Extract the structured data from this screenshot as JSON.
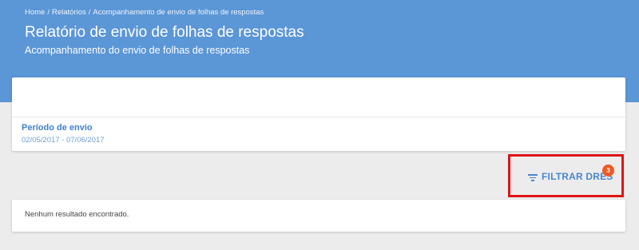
{
  "header": {
    "breadcrumb": [
      "Home",
      "Relatórios",
      "Acompanhamento de envio de folhas de respostas"
    ],
    "title": "Relatório de envio de folhas de respostas",
    "subtitle": "Acompanhamento do envio de folhas de respostas"
  },
  "summary": {
    "period_label": "Período de envio",
    "period_value": "02/05/2017 - 07/06/2017"
  },
  "filter": {
    "label": "FILTRAR DRES",
    "badge_count": "3",
    "icon": "filter-list-icon"
  },
  "results": {
    "empty_message": "Nenhum resultado encontrado."
  },
  "colors": {
    "header_bg": "#5b96d6",
    "accent": "#4a86cf",
    "badge": "#ee5a24",
    "highlight_border": "#e01414"
  }
}
